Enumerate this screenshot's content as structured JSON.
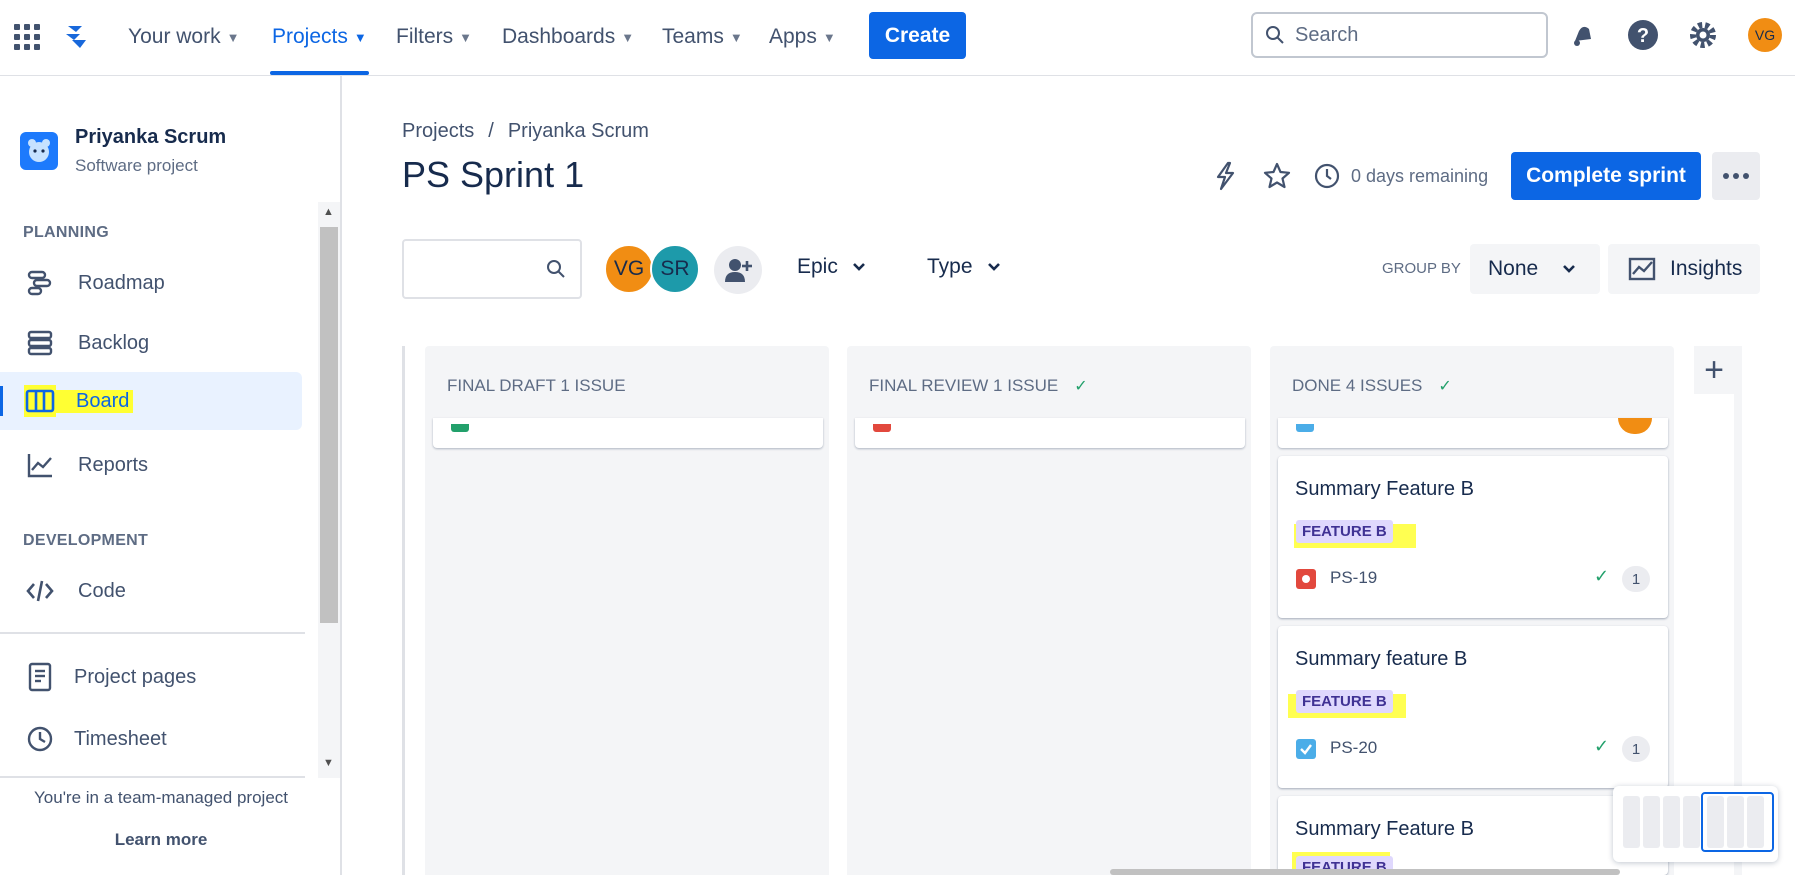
{
  "topnav": {
    "items": [
      {
        "label": "Your work"
      },
      {
        "label": "Projects"
      },
      {
        "label": "Filters"
      },
      {
        "label": "Dashboards"
      },
      {
        "label": "Teams"
      },
      {
        "label": "Apps"
      }
    ],
    "active_item": "Projects",
    "create_label": "Create",
    "search_placeholder": "Search",
    "user_initials": "VG",
    "icons": [
      "apps-grid-icon",
      "jira-logo",
      "notifications-icon",
      "help-icon",
      "settings-icon"
    ]
  },
  "sidebar": {
    "project_name": "Priyanka Scrum",
    "project_type": "Software project",
    "planning_label": "PLANNING",
    "planning_items": [
      {
        "label": "Roadmap",
        "icon": "roadmap-icon"
      },
      {
        "label": "Backlog",
        "icon": "backlog-icon"
      },
      {
        "label": "Board",
        "icon": "board-icon",
        "active": true
      },
      {
        "label": "Reports",
        "icon": "reports-icon"
      }
    ],
    "development_label": "DEVELOPMENT",
    "development_items": [
      {
        "label": "Code",
        "icon": "code-icon"
      }
    ],
    "other_items": [
      {
        "label": "Project pages",
        "icon": "pages-icon"
      },
      {
        "label": "Timesheet",
        "icon": "clock-icon"
      }
    ],
    "team_note": "You're in a team-managed project",
    "learn_more": "Learn more"
  },
  "main": {
    "breadcrumb": [
      "Projects",
      "/",
      "Priyanka Scrum"
    ],
    "title": "PS Sprint 1",
    "days_remaining": "0 days remaining",
    "complete_sprint_label": "Complete sprint",
    "avatars": [
      {
        "initials": "VG",
        "color": "#f18d13"
      },
      {
        "initials": "SR",
        "color": "#1d9aaa"
      }
    ],
    "filters": {
      "epic": "Epic",
      "type": "Type"
    },
    "group_by_label": "GROUP BY",
    "group_by_value": "None",
    "insights_label": "Insights"
  },
  "board": {
    "columns": [
      {
        "title": "FINAL DRAFT 1 ISSUE",
        "done": false,
        "stub_color": "#22a06b"
      },
      {
        "title": "FINAL REVIEW 1 ISSUE",
        "done": true,
        "stub_color": "#e2483d"
      },
      {
        "title": "DONE 4 ISSUES",
        "done": true,
        "stub_color": "#4bade8"
      }
    ],
    "cards": [
      {
        "summary": "Summary Feature B",
        "epic": "FEATURE B",
        "key": "PS-19",
        "type": "bug",
        "count": "1"
      },
      {
        "summary": "Summary feature B",
        "epic": "FEATURE B",
        "key": "PS-20",
        "type": "task",
        "count": "1"
      },
      {
        "summary": "Summary Feature B",
        "epic": "FEATURE B",
        "key": "",
        "type": "",
        "count": ""
      }
    ],
    "colors": {
      "accent": "#0c66e4",
      "highlight": "#ffff33",
      "bug": "#e2483d",
      "task": "#4bade8",
      "done_check": "#22a06b"
    }
  }
}
